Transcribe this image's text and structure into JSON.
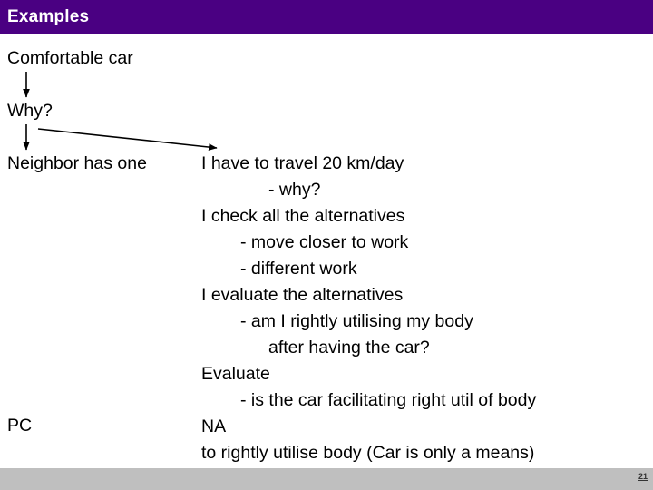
{
  "slide": {
    "title": "Examples",
    "page_number": "21"
  },
  "colors": {
    "banner": "#4a0082",
    "banner_text": "#ffffff",
    "body_text": "#000000",
    "footer_bar": "#bfbfbf",
    "arrow": "#000000"
  },
  "left_column": {
    "items": [
      {
        "label": "Comfortable car"
      },
      {
        "label": "Why?"
      },
      {
        "label": "Neighbor has one"
      },
      {
        "label": "PC"
      }
    ]
  },
  "right_column": {
    "lines": [
      {
        "text": "I have to travel 20 km/day",
        "indent": 0
      },
      {
        "text": "- why?",
        "indent": 2
      },
      {
        "text": "I check all the alternatives",
        "indent": 0
      },
      {
        "text": "- move closer to work",
        "indent": 1
      },
      {
        "text": "- different work",
        "indent": 1
      },
      {
        "text": "I evaluate the alternatives",
        "indent": 0
      },
      {
        "text": "- am I rightly utilising my body",
        "indent": 1
      },
      {
        "text": "after having the car?",
        "indent": 2
      },
      {
        "text": "Evaluate",
        "indent": 0
      },
      {
        "text": "- is the car facilitating right util of body",
        "indent": 1
      },
      {
        "text": "NA",
        "indent": 0
      },
      {
        "text": "to rightly utilise body (Car is only a means)",
        "indent": 0
      }
    ]
  },
  "connectors": [
    {
      "name": "arrow-comfortable-to-why",
      "kind": "vertical-arrow"
    },
    {
      "name": "arrow-why-to-neighbor",
      "kind": "vertical-arrow"
    },
    {
      "name": "arrow-why-to-right-column",
      "kind": "diagonal-arrow"
    }
  ]
}
